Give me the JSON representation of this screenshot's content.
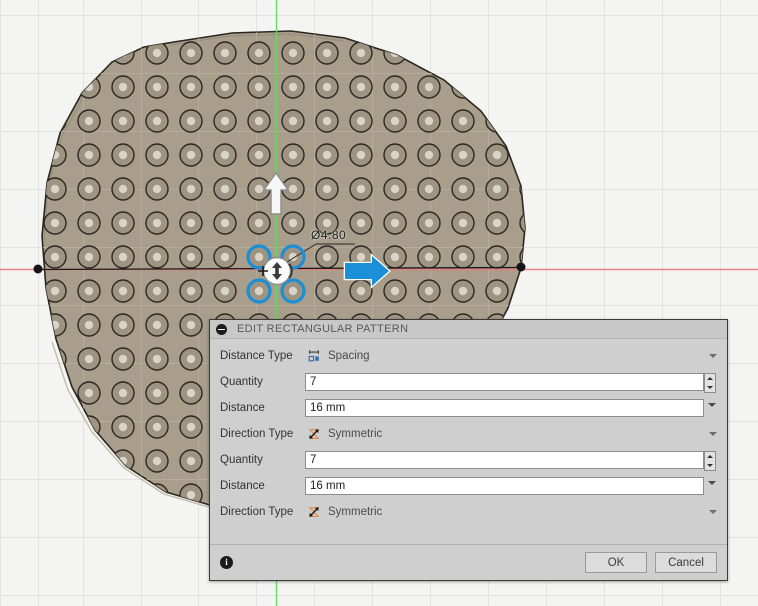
{
  "viewport": {
    "dimension_label": "Ø4.80",
    "background_color": "#f4f4f2",
    "grid_color": "#e0e0de",
    "body_color": "#a39986",
    "x_axis_color": "#f08a8a",
    "y_axis_color": "#6ee06e",
    "selection_color": "#1b8fd6",
    "handle_arrow_color": "#1f8fd8"
  },
  "dialog": {
    "title": "EDIT RECTANGULAR PATTERN",
    "collapse_icon": "minus-circle-icon",
    "rows": [
      {
        "label": "Distance Type",
        "type": "combo",
        "icon": "spacing-icon",
        "value": "Spacing"
      },
      {
        "label": "Quantity",
        "type": "spinner",
        "value": "7"
      },
      {
        "label": "Distance",
        "type": "dropdown-field",
        "value": "16 mm"
      },
      {
        "label": "Direction Type",
        "type": "combo",
        "icon": "symmetric-icon",
        "value": "Symmetric"
      },
      {
        "label": "Quantity",
        "type": "spinner",
        "value": "7"
      },
      {
        "label": "Distance",
        "type": "dropdown-field",
        "value": "16 mm"
      },
      {
        "label": "Direction Type",
        "type": "combo",
        "icon": "symmetric-icon",
        "value": "Symmetric"
      }
    ],
    "footer": {
      "info_icon": "info-icon",
      "info_glyph": "i",
      "ok_label": "OK",
      "cancel_label": "Cancel"
    }
  }
}
